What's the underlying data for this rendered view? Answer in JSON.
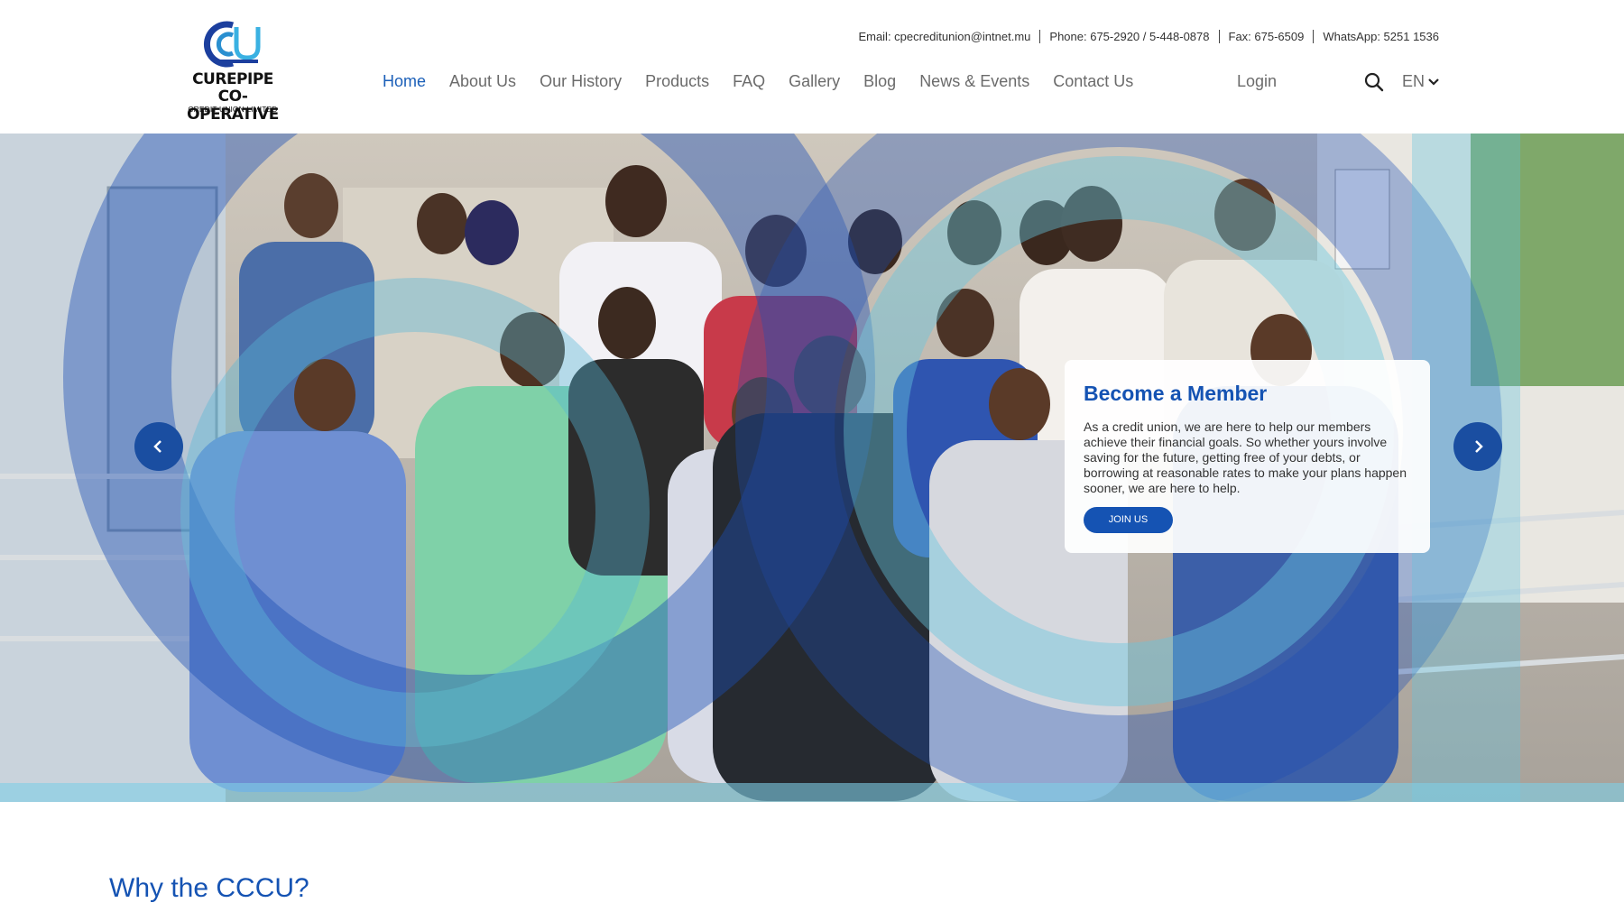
{
  "brand": {
    "line1": "CUREPIPE",
    "line2": "CO-OPERATIVE",
    "line3": "CREDIT UNION LIMITED"
  },
  "contact": {
    "email": "Email: cpecreditunion@intnet.mu",
    "phone": "Phone: 675-2920 / 5-448-0878",
    "fax": "Fax: 675-6509",
    "whatsapp": "WhatsApp: 5251 1536"
  },
  "nav": {
    "items": [
      "Home",
      "About Us",
      "Our History",
      "Products",
      "FAQ",
      "Gallery",
      "Blog",
      "News & Events",
      "Contact Us"
    ],
    "active": "Home",
    "login": "Login",
    "language": "EN"
  },
  "hero": {
    "title": "Become a Member",
    "body": "As a credit union, we are here to help our members achieve their financial goals. So whether yours involve saving for the future, getting free of your debts, or borrowing at reasonable rates to make your plans happen sooner, we are here to help.",
    "cta": "JOIN US"
  },
  "section": {
    "heading": "Why the CCCU?"
  },
  "colors": {
    "accent": "#1553b3",
    "arrow": "#1a4ea1",
    "nav_text": "#6b6b6b"
  },
  "icons": {
    "search": "search-icon",
    "chevron": "chevron-down-icon",
    "prev": "chevron-left-icon",
    "next": "chevron-right-icon"
  }
}
